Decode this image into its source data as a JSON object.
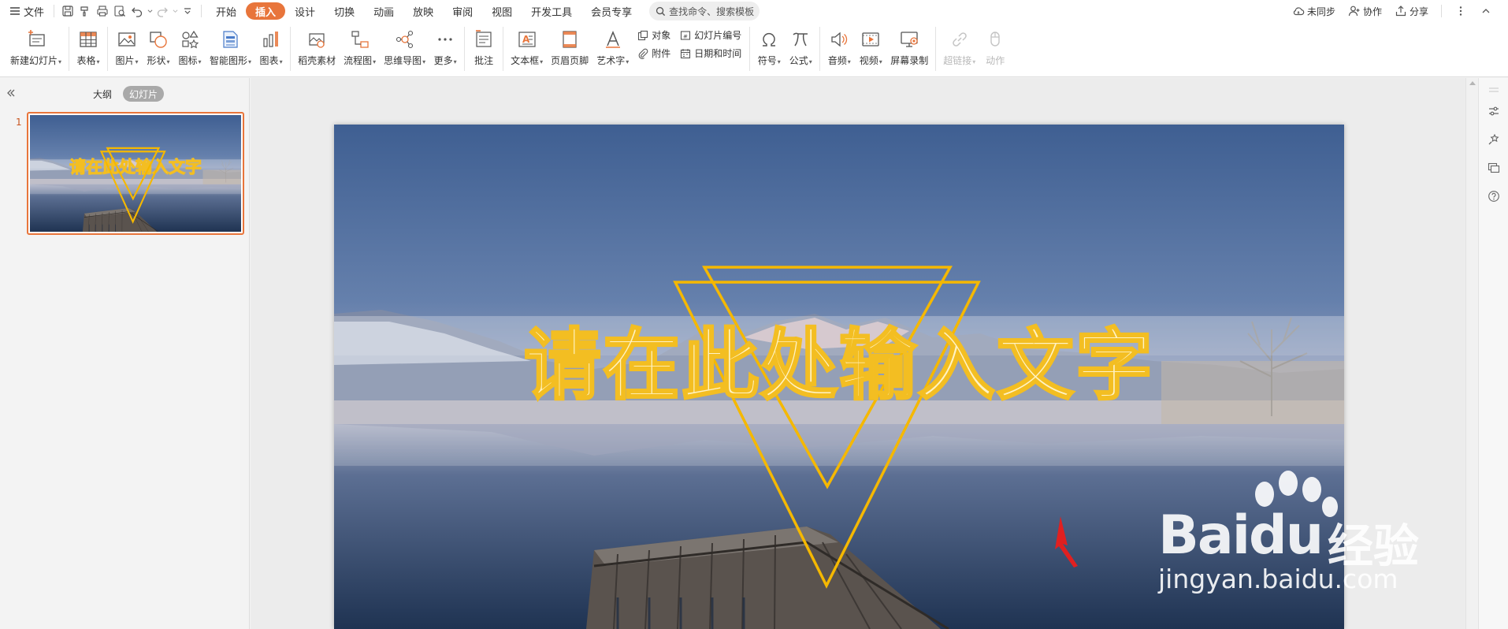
{
  "menubar": {
    "file_label": "文件",
    "tabs": [
      "开始",
      "插入",
      "设计",
      "切换",
      "动画",
      "放映",
      "审阅",
      "视图",
      "开发工具",
      "会员专享"
    ],
    "active_tab_index": 1,
    "search_placeholder": "查找命令、搜索模板",
    "right": {
      "sync_label": "未同步",
      "collab_label": "协作",
      "share_label": "分享"
    }
  },
  "ribbon": {
    "new_slide": "新建幻灯片",
    "table": "表格",
    "picture": "图片",
    "shape": "形状",
    "icon": "图标",
    "smart_graphic": "智能图形",
    "chart": "图表",
    "material": "稻壳素材",
    "flowchart": "流程图",
    "mindmap": "思维导图",
    "more": "更多",
    "comment": "批注",
    "textbox": "文本框",
    "header_footer": "页眉页脚",
    "wordart": "艺术字",
    "object": "对象",
    "attachment": "附件",
    "slide_number": "幻灯片编号",
    "date_time": "日期和时间",
    "symbol": "符号",
    "formula": "公式",
    "audio": "音频",
    "video": "视频",
    "screen_record": "屏幕录制",
    "hyperlink": "超链接",
    "action": "动作"
  },
  "left_panel": {
    "tabs": [
      "大纲",
      "幻灯片"
    ],
    "active_tab_index": 1,
    "slides": [
      {
        "number": "1",
        "title": "请在此处输入文字"
      }
    ]
  },
  "slide": {
    "title": "请在此处输入文字"
  },
  "watermark": {
    "logo_text": "Bai",
    "logo_du": "du",
    "cn_text": "经验",
    "url": "jingyan.baidu.com"
  },
  "colors": {
    "accent": "#e8753b",
    "title_fill": "#fff3c4",
    "title_stroke": "#f3be22",
    "triangle": "#f5b800",
    "annotation_arrow": "#e02020"
  }
}
